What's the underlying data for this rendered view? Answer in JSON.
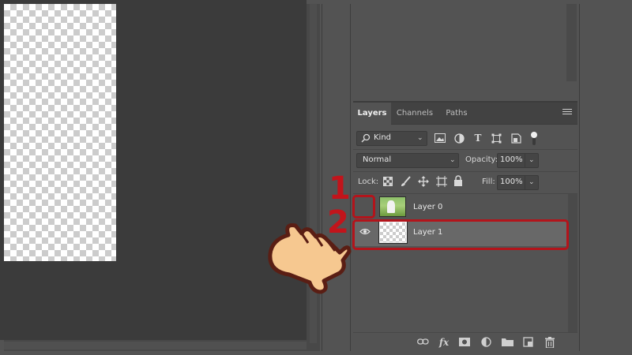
{
  "layers_panel": {
    "tabs": [
      {
        "label": "Layers",
        "active": true
      },
      {
        "label": "Channels",
        "active": false
      },
      {
        "label": "Paths",
        "active": false
      }
    ],
    "filter": {
      "kind_label": "Kind",
      "icons": [
        "image-filter-icon",
        "adjustment-filter-icon",
        "type-filter-icon",
        "shape-filter-icon",
        "smart-object-filter-icon",
        "filter-toggle-icon"
      ]
    },
    "blend_mode": "Normal",
    "opacity_label": "Opacity:",
    "opacity_value": "100%",
    "lock_label": "Lock:",
    "lock_icons": [
      "lock-transparent-icon",
      "lock-paint-icon",
      "lock-position-icon",
      "lock-artboard-icon",
      "lock-all-icon"
    ],
    "fill_label": "Fill:",
    "fill_value": "100%",
    "layers": [
      {
        "name": "Layer 0",
        "visible": false,
        "selected": false
      },
      {
        "name": "Layer 1",
        "visible": true,
        "selected": true
      }
    ],
    "bottom_icons": [
      "link-layers-icon",
      "fx-icon",
      "layer-mask-icon",
      "adjustment-layer-icon",
      "group-folder-icon",
      "new-layer-icon",
      "trash-icon"
    ]
  },
  "annotations": {
    "step1": "1",
    "step2": "2",
    "color": "#c2141b"
  },
  "colors": {
    "panel_bg": "#535353",
    "canvas_bg": "#3b3b3b",
    "selected_row": "#686868",
    "accent_red": "#b3141b"
  }
}
